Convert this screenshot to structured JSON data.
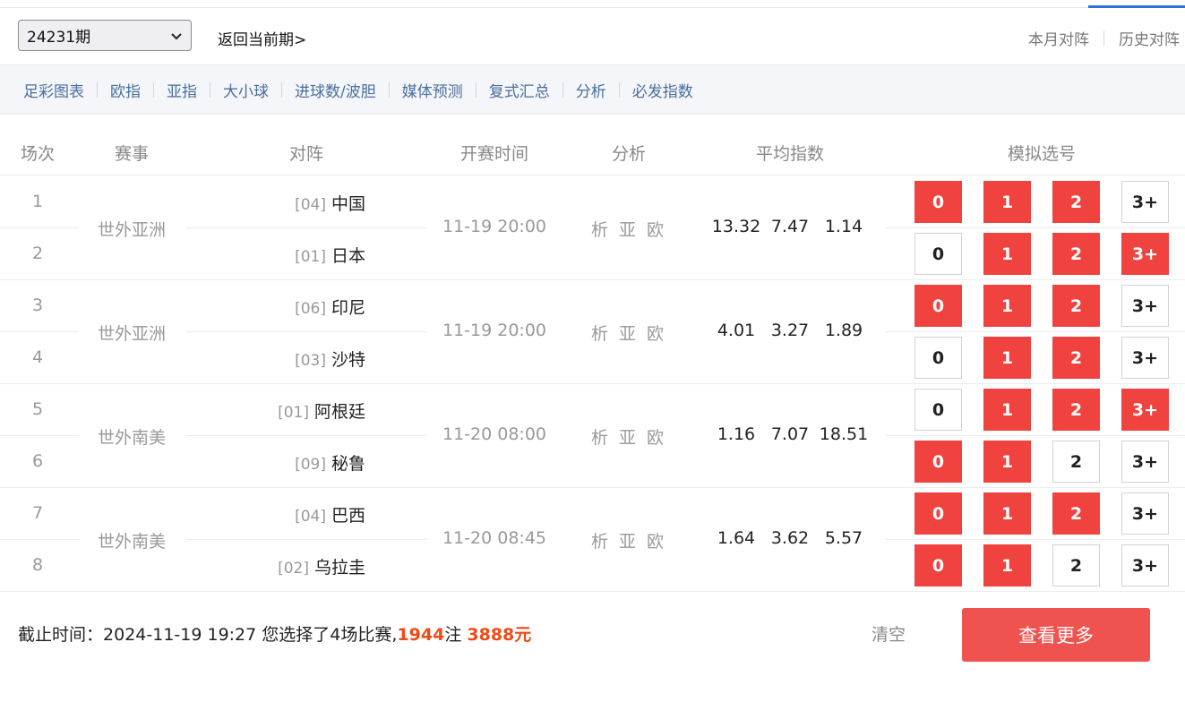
{
  "header": {
    "period_selected": "24231期",
    "back_link": "返回当前期>",
    "right_links": [
      "本月对阵",
      "历史对阵"
    ]
  },
  "subnav": [
    "足彩图表",
    "欧指",
    "亚指",
    "大小球",
    "进球数/波胆",
    "媒体预测",
    "复式汇总",
    "分析",
    "必发指数"
  ],
  "columns": [
    "场次",
    "赛事",
    "对阵",
    "开赛时间",
    "分析",
    "平均指数",
    "模拟选号"
  ],
  "matches": [
    {
      "league": "世外亚洲",
      "time": "11-19 20:00",
      "analysis": "析 亚 欧",
      "odds": [
        "13.32",
        "7.47",
        "1.14"
      ],
      "teams": [
        {
          "num": "1",
          "tag": "[04]",
          "name": "中国",
          "picks": [
            true,
            true,
            true,
            false
          ]
        },
        {
          "num": "2",
          "tag": "[01]",
          "name": "日本",
          "picks": [
            false,
            true,
            true,
            true
          ]
        }
      ]
    },
    {
      "league": "世外亚洲",
      "time": "11-19 20:00",
      "analysis": "析 亚 欧",
      "odds": [
        "4.01",
        "3.27",
        "1.89"
      ],
      "teams": [
        {
          "num": "3",
          "tag": "[06]",
          "name": "印尼",
          "picks": [
            true,
            true,
            true,
            false
          ]
        },
        {
          "num": "4",
          "tag": "[03]",
          "name": "沙特",
          "picks": [
            false,
            true,
            true,
            false
          ]
        }
      ]
    },
    {
      "league": "世外南美",
      "time": "11-20 08:00",
      "analysis": "析 亚 欧",
      "odds": [
        "1.16",
        "7.07",
        "18.51"
      ],
      "teams": [
        {
          "num": "5",
          "tag": "[01]",
          "name": "阿根廷",
          "picks": [
            false,
            true,
            true,
            true
          ]
        },
        {
          "num": "6",
          "tag": "[09]",
          "name": "秘鲁",
          "picks": [
            true,
            true,
            false,
            false
          ]
        }
      ]
    },
    {
      "league": "世外南美",
      "time": "11-20 08:45",
      "analysis": "析 亚 欧",
      "odds": [
        "1.64",
        "3.62",
        "5.57"
      ],
      "teams": [
        {
          "num": "7",
          "tag": "[04]",
          "name": "巴西",
          "picks": [
            true,
            true,
            true,
            false
          ]
        },
        {
          "num": "8",
          "tag": "[02]",
          "name": "乌拉圭",
          "picks": [
            true,
            true,
            false,
            false
          ]
        }
      ]
    }
  ],
  "pick_labels": [
    "0",
    "1",
    "2",
    "3+"
  ],
  "footer": {
    "deadline_label": "截止时间：",
    "deadline": "2024-11-19 19:27",
    "selected_text": "您选择了4场比赛,",
    "bets": "1944",
    "bets_unit": "注",
    "amount": "3888元",
    "clear": "清空",
    "more": "查看更多"
  },
  "colors": {
    "accent": "#2f6fd6",
    "pick_on": "#f0423f",
    "highlight": "#f04a17",
    "button": "#f0534f"
  }
}
